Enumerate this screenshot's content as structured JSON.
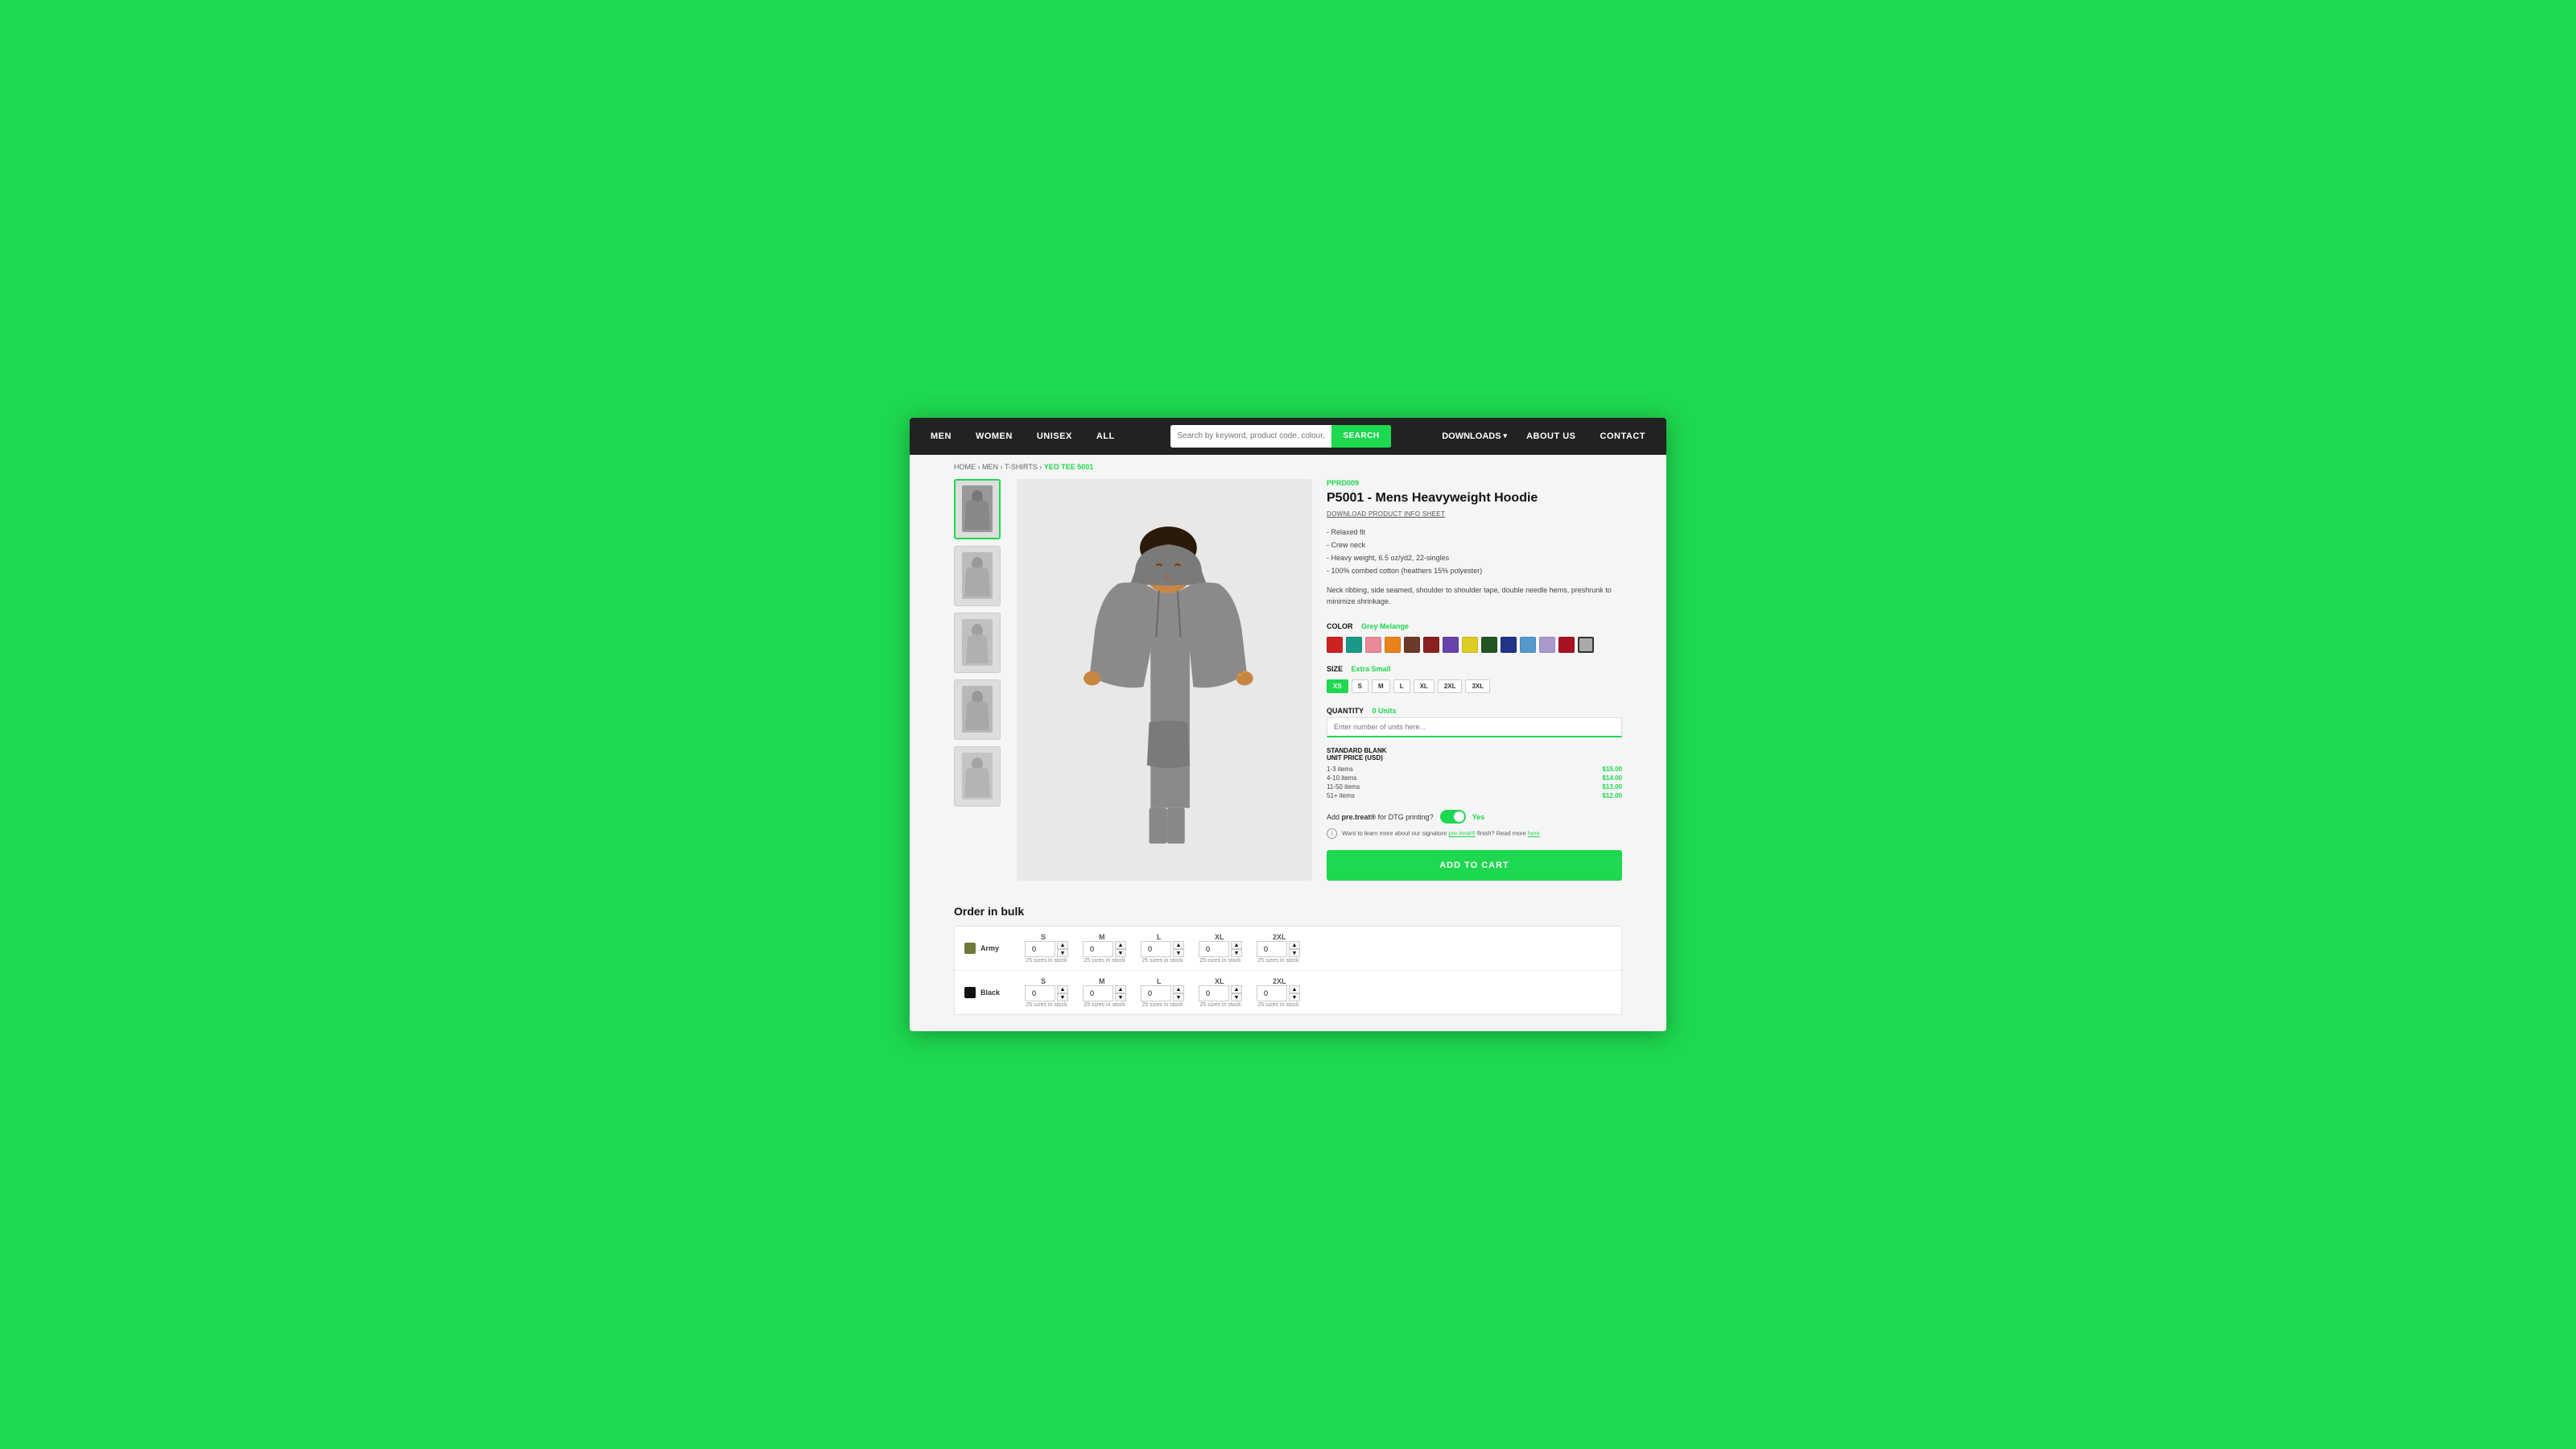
{
  "nav": {
    "links": [
      "MEN",
      "WOMEN",
      "UNISEX",
      "ALL"
    ],
    "search_placeholder": "Search by keyword, product code, colour, style and more...",
    "search_btn": "SEARCH",
    "downloads_label": "DOWNLOADS",
    "about_us": "ABOUT US",
    "contact": "CONTACT"
  },
  "breadcrumb": {
    "home": "HOME",
    "men": "MEN",
    "tshirts": "T-SHIRTS",
    "current": "YEO TEE 5001"
  },
  "product": {
    "id": "PPRD009",
    "title": "P5001 - Mens Heavyweight Hoodie",
    "download_link": "DOWNLOAD PRODUCT INFO SHEET",
    "features": [
      "- Relaxed fit",
      "- Crew neck",
      "- Heavy weight, 6.5 oz/yd2, 22-singles",
      "- 100% combed cotton (heathers 15% polyester)"
    ],
    "description": "Neck ribbing, side seamed, shoulder to shoulder tape, double needle hems, preshrunk to minimize shrinkage.",
    "color_label": "COLOR",
    "color_selected": "Grey Melange",
    "colors": [
      {
        "name": "Red",
        "hex": "#cc2222"
      },
      {
        "name": "Teal",
        "hex": "#1a9988"
      },
      {
        "name": "Pink",
        "hex": "#e88a9a"
      },
      {
        "name": "Orange",
        "hex": "#e8821a"
      },
      {
        "name": "Brown",
        "hex": "#6b3a2a"
      },
      {
        "name": "Dark Maroon",
        "hex": "#8b2020"
      },
      {
        "name": "Purple",
        "hex": "#6644aa"
      },
      {
        "name": "Yellow",
        "hex": "#ddcc22"
      },
      {
        "name": "Green",
        "hex": "#225522"
      },
      {
        "name": "Navy",
        "hex": "#223388"
      },
      {
        "name": "Light Blue",
        "hex": "#5599cc"
      },
      {
        "name": "Lavender",
        "hex": "#aa99cc"
      },
      {
        "name": "Crimson",
        "hex": "#aa1122"
      },
      {
        "name": "Grey Melange",
        "hex": "#aaaaaa",
        "selected": true
      }
    ],
    "size_label": "SIZE",
    "size_selected": "Extra Small",
    "sizes": [
      "XS",
      "S",
      "M",
      "L",
      "XL",
      "2XL",
      "3XL"
    ],
    "quantity_label": "QUANTITY",
    "quantity_units": "0 Units",
    "quantity_placeholder": "Enter number of units here...",
    "pricing_title": "STANDARD BLANK",
    "pricing_subtitle": "UNIT PRICE (USD)",
    "pricing_rows": [
      {
        "range": "1-3 items",
        "price": "$15.00"
      },
      {
        "range": "4-10 items",
        "price": "$14.00"
      },
      {
        "range": "11-50 items",
        "price": "$13.00"
      },
      {
        "range": "51+ items",
        "price": "$12.00"
      }
    ],
    "pretreat_label": "Add pre.treat® for DTG printing?",
    "pretreat_value": "Yes",
    "pretreat_note": "Want to learn more about our signature pre.treat® finish? Read more here",
    "add_to_cart": "ADD TO CART"
  },
  "bulk": {
    "title": "Order in bulk",
    "rows": [
      {
        "color": "Army",
        "color_hex": "#6b7a3a",
        "sizes": [
          "S",
          "M",
          "L",
          "XL",
          "2XL"
        ],
        "values": [
          0,
          0,
          0,
          0,
          0
        ],
        "stock": "25 sizes in stock"
      },
      {
        "color": "Black",
        "color_hex": "#111111",
        "sizes": [
          "S",
          "M",
          "L",
          "XL",
          "2XL"
        ],
        "values": [
          0,
          0,
          0,
          0,
          0
        ],
        "stock": "25 sizes in stock"
      }
    ]
  }
}
